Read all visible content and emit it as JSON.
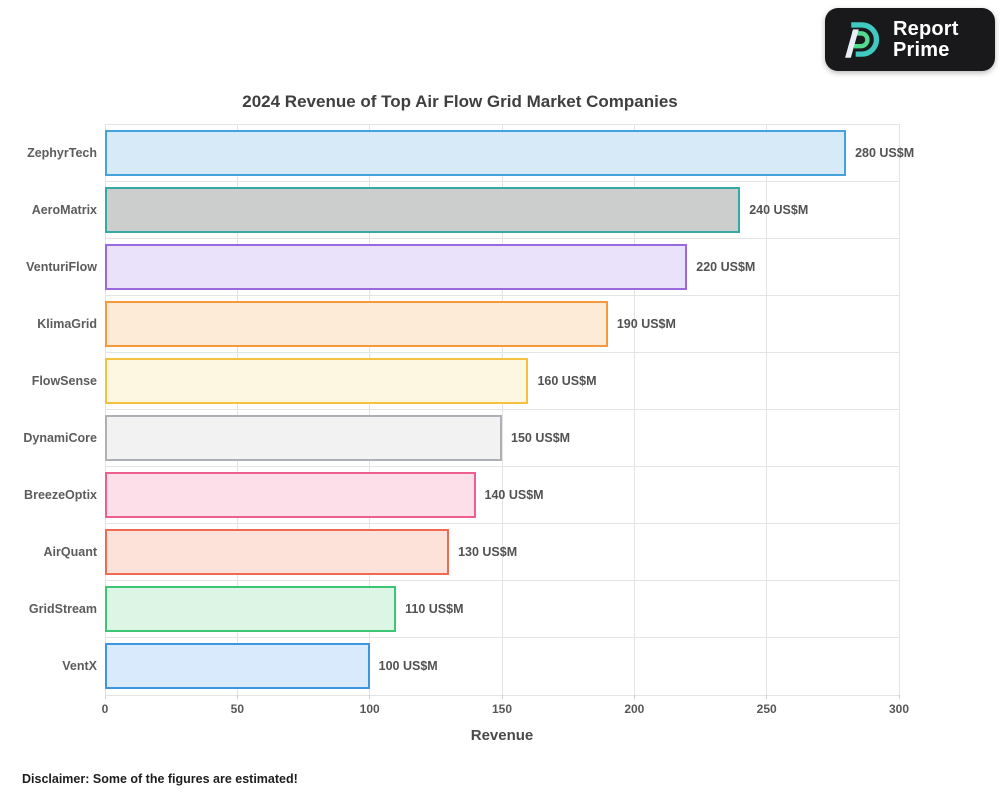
{
  "logo": {
    "line1": "Report",
    "line2": "Prime",
    "bg_color": "#19191b",
    "mark_teal": "#3fc9c0",
    "mark_green": "#54da8e",
    "mark_white": "#e9edf6"
  },
  "chart_data": {
    "type": "bar",
    "orientation": "horizontal",
    "title": "2024 Revenue of Top Air Flow Grid Market Companies",
    "xlabel": "Revenue",
    "unit_suffix": " US$M",
    "xlim": [
      0,
      300
    ],
    "xticks": [
      0,
      50,
      100,
      150,
      200,
      250,
      300
    ],
    "grid": true,
    "legend": "none",
    "categories": [
      "ZephyrTech",
      "AeroMatrix",
      "VenturiFlow",
      "KlimaGrid",
      "FlowSense",
      "DynamiCore",
      "BreezeOptix",
      "AirQuant",
      "GridStream",
      "VentX"
    ],
    "values": [
      280,
      240,
      220,
      190,
      160,
      150,
      140,
      130,
      110,
      100
    ],
    "value_labels": [
      "280 US$M",
      "240 US$M",
      "220 US$M",
      "190 US$M",
      "160 US$M",
      "150 US$M",
      "140 US$M",
      "130 US$M",
      "110 US$M",
      "100 US$M"
    ],
    "bar_colors": [
      {
        "fill": "#d6eaf8",
        "border": "#45a2dd"
      },
      {
        "fill": "#cbcecd",
        "border": "#34aaa5"
      },
      {
        "fill": "#eae1fb",
        "border": "#9b69de"
      },
      {
        "fill": "#fdead7",
        "border": "#f59a3c"
      },
      {
        "fill": "#fdf6e0",
        "border": "#f3c13e"
      },
      {
        "fill": "#f2f2f3",
        "border": "#adb1b5"
      },
      {
        "fill": "#fcdfe9",
        "border": "#ee5f8e"
      },
      {
        "fill": "#fde2d9",
        "border": "#ef6a50"
      },
      {
        "fill": "#dcf5e5",
        "border": "#3ec573"
      },
      {
        "fill": "#d8eafb",
        "border": "#3f96e0"
      }
    ],
    "gridline_color": "#e4e4e4"
  },
  "footer": {
    "disclaimer": "Disclaimer: Some of the figures are estimated!"
  }
}
